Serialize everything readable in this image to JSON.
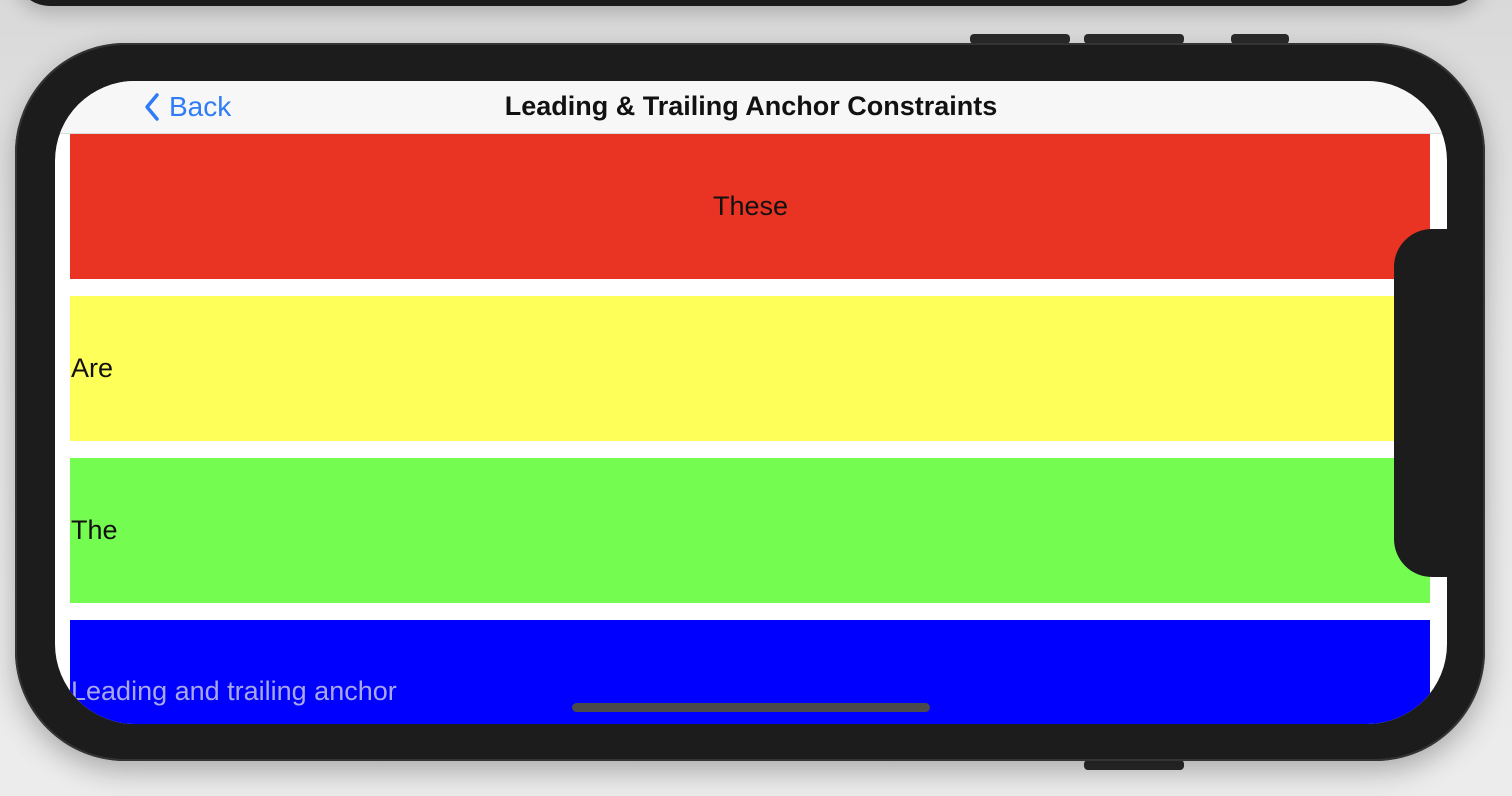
{
  "nav": {
    "back_label": "Back",
    "title": "Leading & Trailing Anchor Constraints"
  },
  "rows": [
    {
      "label": "These",
      "color": "#e93424"
    },
    {
      "label": "Are",
      "color": "#ffff59"
    },
    {
      "label": "The",
      "color": "#75fc51"
    },
    {
      "label": "Leading and trailing anchor",
      "color": "#0000ff"
    }
  ],
  "colors": {
    "accent": "#2f7cf6",
    "device": "#1c1c1c",
    "navbar": "#f7f7f7"
  },
  "icons": {
    "back": "chevron-left-icon"
  }
}
